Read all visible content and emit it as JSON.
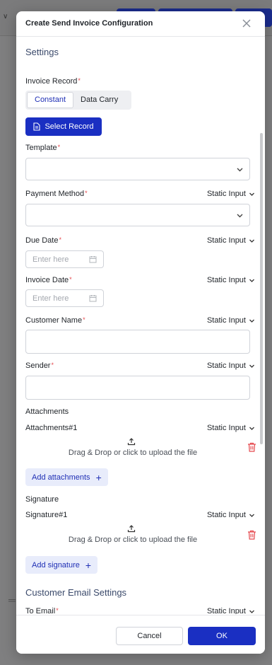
{
  "modal": {
    "title": "Create Send Invoice Configuration"
  },
  "settings": {
    "section_title": "Settings",
    "invoice_record": {
      "label": "Invoice Record",
      "required": "*",
      "tabs": [
        "Constant",
        "Data Carry"
      ],
      "active_tab": "Constant",
      "select_button": "Select Record"
    },
    "template": {
      "label": "Template",
      "required": "*",
      "value": ""
    },
    "payment_method": {
      "label": "Payment Method",
      "required": "*",
      "mode": "Static Input",
      "value": ""
    },
    "due_date": {
      "label": "Due Date",
      "required": "*",
      "mode": "Static Input",
      "placeholder": "Enter here"
    },
    "invoice_date": {
      "label": "Invoice Date",
      "required": "*",
      "mode": "Static Input",
      "placeholder": "Enter here"
    },
    "customer_name": {
      "label": "Customer Name",
      "required": "*",
      "mode": "Static Input",
      "value": ""
    },
    "sender": {
      "label": "Sender",
      "required": "*",
      "mode": "Static Input",
      "value": ""
    },
    "attachments": {
      "label": "Attachments",
      "item_label": "Attachments#1",
      "mode": "Static Input",
      "upload_text": "Drag & Drop or click to upload the file",
      "add_button": "Add attachments"
    },
    "signature": {
      "label": "Signature",
      "item_label": "Signature#1",
      "mode": "Static Input",
      "upload_text": "Drag & Drop or click to upload the file",
      "add_button": "Add signature"
    }
  },
  "customer_email": {
    "section_title": "Customer Email Settings",
    "to_email": {
      "label": "To Email",
      "required": "*",
      "mode": "Static Input"
    }
  },
  "footer": {
    "cancel": "Cancel",
    "ok": "OK"
  },
  "colors": {
    "primary": "#1a2fc2",
    "required": "#e5484d",
    "danger": "#e5484d",
    "soft_button_bg": "#e8ecfb"
  },
  "icons": {
    "close": "close-icon",
    "chevron": "chevron-down-icon",
    "document": "document-icon",
    "calendar": "calendar-icon",
    "upload": "upload-icon",
    "trash": "trash-icon",
    "plus": "plus-icon"
  }
}
